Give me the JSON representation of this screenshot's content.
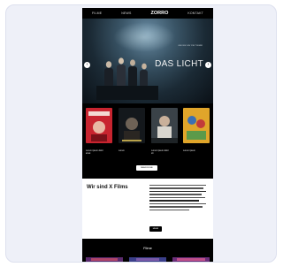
{
  "nav": {
    "items": [
      "FILME",
      "NEWS",
      "KONTAKT"
    ],
    "logo": "ZORRO"
  },
  "hero": {
    "title": "DAS LICHT",
    "credits": "EIN FILM VON TOM TYKWER",
    "prev_icon": "chevron-left-icon",
    "next_icon": "chevron-right-icon"
  },
  "posters": [
    {
      "caption_1": "Lorem ipsum dolor",
      "caption_2": "amet"
    },
    {
      "caption_1": "Lorem",
      "caption_2": ""
    },
    {
      "caption_1": "Lorem ipsum dolor",
      "caption_2": "sit"
    },
    {
      "caption_1": "Lorem ipsum",
      "caption_2": ""
    }
  ],
  "more_button": "MEHR FILME",
  "about": {
    "title": "Wir sind X Films",
    "button": "MEHR"
  },
  "films_section": {
    "title": "Filme"
  },
  "colors": {
    "page_bg": "#000000",
    "card_bg": "#eef0f8",
    "about_bg": "#ffffff"
  }
}
